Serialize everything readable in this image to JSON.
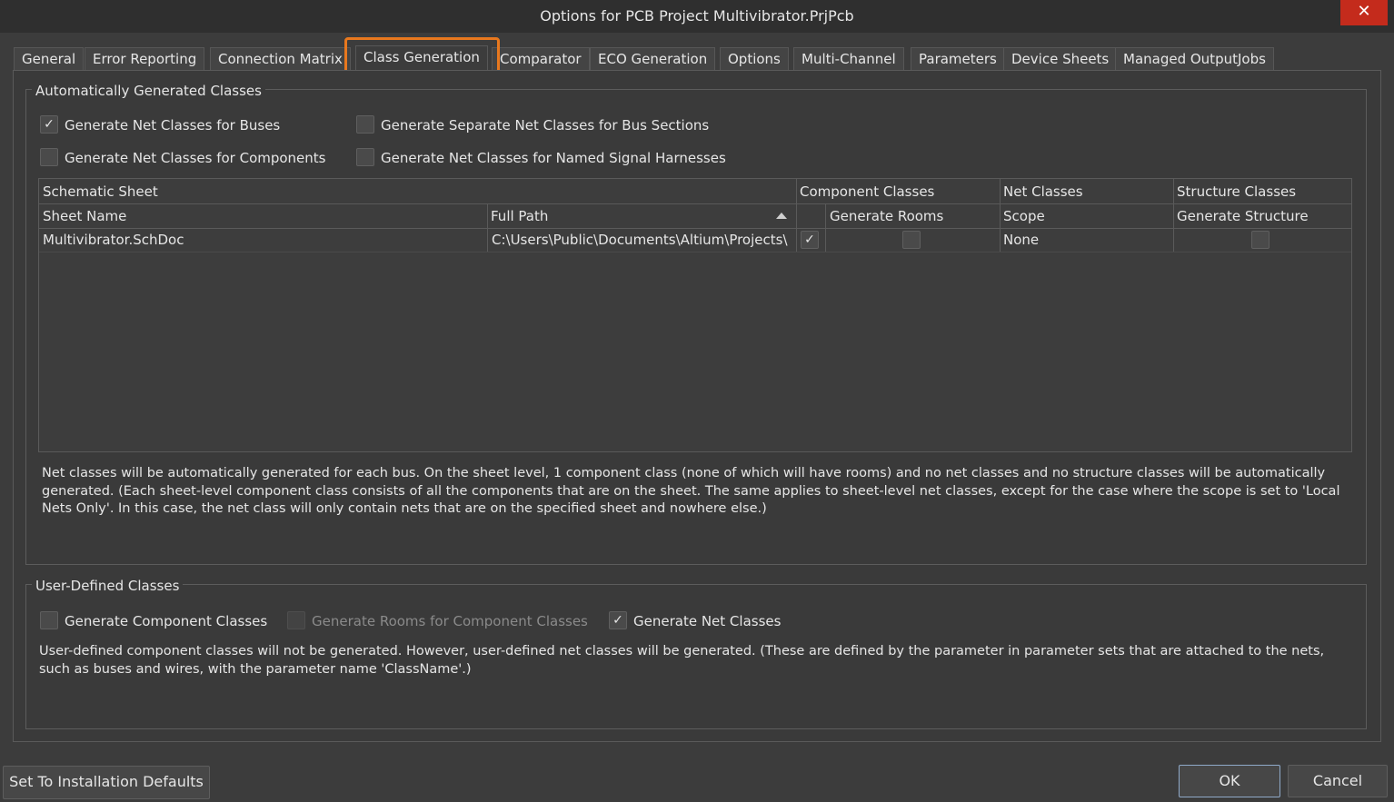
{
  "window": {
    "title": "Options for PCB Project Multivibrator.PrjPcb",
    "close_glyph": "✕"
  },
  "tabs": [
    {
      "label": "General"
    },
    {
      "label": "Error Reporting"
    },
    {
      "label": "Connection Matrix"
    },
    {
      "label": "Class Generation",
      "active": true
    },
    {
      "label": "Comparator"
    },
    {
      "label": "ECO Generation"
    },
    {
      "label": "Options"
    },
    {
      "label": "Multi-Channel"
    },
    {
      "label": "Parameters"
    },
    {
      "label": "Device Sheets"
    },
    {
      "label": "Managed OutputJobs"
    }
  ],
  "auto": {
    "legend": "Automatically Generated Classes",
    "options": [
      {
        "label": "Generate Net Classes for Buses",
        "checked": true
      },
      {
        "label": "Generate Separate Net Classes for Bus Sections",
        "checked": false
      },
      {
        "label": "Generate Net Classes for Components",
        "checked": false
      },
      {
        "label": "Generate Net Classes for Named Signal Harnesses",
        "checked": false
      }
    ],
    "grid": {
      "group_headers": {
        "schematic": "Schematic Sheet",
        "component": "Component Classes",
        "net": "Net Classes",
        "structure": "Structure Classes"
      },
      "columns": {
        "sheet_name": "Sheet Name",
        "full_path": "Full Path",
        "generate_rooms": "Generate Rooms",
        "scope": "Scope",
        "generate_structure": "Generate Structure"
      },
      "rows": [
        {
          "sheet_name": "Multivibrator.SchDoc",
          "full_path": "C:\\Users\\Public\\Documents\\Altium\\Projects\\",
          "component_class": true,
          "generate_rooms": false,
          "scope": "None",
          "generate_structure": false
        }
      ]
    },
    "description": "Net classes will be automatically generated for each bus. On the sheet level, 1 component class (none of which will have rooms) and no net classes and no structure classes will be automatically generated. (Each sheet-level component class consists of all the components that are on the sheet. The same applies to sheet-level net classes, except for the case where the scope is set to 'Local Nets Only'. In this case, the net class will only contain nets that are on the specified sheet and nowhere else.)"
  },
  "user": {
    "legend": "User-Defined Classes",
    "options": [
      {
        "label": "Generate Component Classes",
        "checked": false,
        "disabled": false
      },
      {
        "label": "Generate Rooms for Component Classes",
        "checked": false,
        "disabled": true
      },
      {
        "label": "Generate Net Classes",
        "checked": true,
        "disabled": false
      }
    ],
    "description": "User-defined component classes will not be generated. However, user-defined net classes will be generated. (These are defined by the parameter in parameter sets that are attached to the nets, such as buses and wires, with the parameter name 'ClassName'.)"
  },
  "footer": {
    "defaults_label": "Set To Installation Defaults",
    "ok_label": "OK",
    "cancel_label": "Cancel"
  },
  "check_glyph": "✓"
}
